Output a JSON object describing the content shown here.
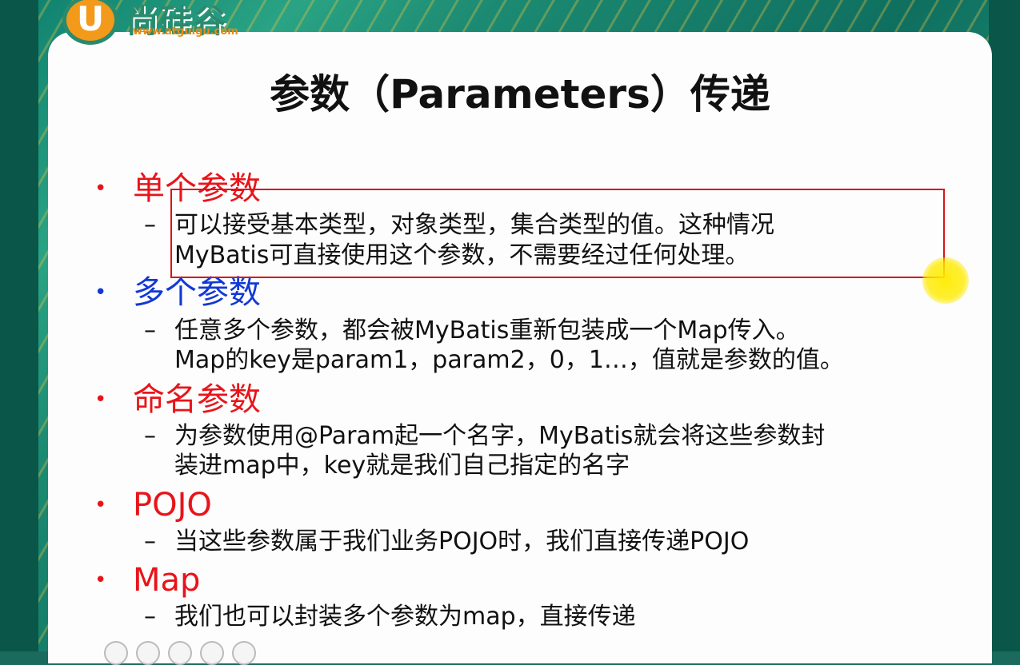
{
  "logo": {
    "letter": "U",
    "text": "尚硅谷",
    "url": "www.atguigu.com"
  },
  "title": "参数（Parameters）传递",
  "sections": [
    {
      "label": "单个参数",
      "color": "#e8141a",
      "lines": [
        "可以接受基本类型，对象类型，集合类型的值。这种情况",
        "MyBatis可直接使用这个参数，不需要经过任何处理。"
      ]
    },
    {
      "label": "多个参数",
      "color": "#1238d6",
      "lines": [
        "任意多个参数，都会被MyBatis重新包装成一个Map传入。",
        "Map的key是param1，param2，0，1…，值就是参数的值。"
      ]
    },
    {
      "label": "命名参数",
      "color": "#e8141a",
      "lines": [
        "为参数使用@Param起一个名字，MyBatis就会将这些参数封",
        "装进map中，key就是我们自己指定的名字"
      ]
    },
    {
      "label": "POJO",
      "color": "#e8141a",
      "lines": [
        "当这些参数属于我们业务POJO时，我们直接传递POJO"
      ]
    },
    {
      "label": "Map",
      "color": "#e8141a",
      "lines": [
        "我们也可以封装多个参数为map，直接传递"
      ]
    }
  ],
  "bullet_symbol": "•",
  "dash_symbol": "–",
  "colors": {
    "red": "#e8141a",
    "blue": "#1238d6",
    "highlight_box": "#d8151b",
    "pointer": "#ffeb00"
  }
}
